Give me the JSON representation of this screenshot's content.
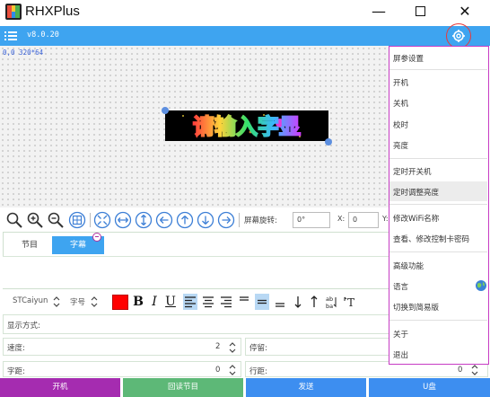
{
  "app": {
    "title": "RHXPlus"
  },
  "toolbar": {
    "version": "v8.0.20"
  },
  "canvas": {
    "coord_label": "0,0 320*64",
    "led_text": "请输入字显"
  },
  "tools": {
    "rotation_label": "屏幕旋转:",
    "rotation_value": "0°",
    "x_label": "X:",
    "x_value": "0",
    "y_label": "Y:"
  },
  "tabs": {
    "program": "节目",
    "subtitle": "字幕"
  },
  "format": {
    "font_name": "STCaiyun",
    "font_size_label": "字号",
    "color": "#ff0000"
  },
  "fields": {
    "display_mode_label": "显示方式:",
    "speed_label": "速度:",
    "speed_value": "2",
    "stay_label": "停留:",
    "spacing_label": "字距:",
    "spacing_value": "0",
    "line_spacing_label": "行距:",
    "line_spacing_value": "0"
  },
  "bottom": {
    "power": "开机",
    "read": "回读节目",
    "send": "发送",
    "usb": "U盘"
  },
  "menu": {
    "screen_params": "屏参设置",
    "power_on": "开机",
    "power_off": "关机",
    "sync_time": "校时",
    "brightness": "亮度",
    "timed_power": "定时开关机",
    "timed_brightness": "定时调整亮度",
    "wifi_name": "修改WiFi名称",
    "card_password": "查看、修改控制卡密码",
    "advanced": "高级功能",
    "language": "语言",
    "simple_mode": "切换到简易版",
    "about": "关于",
    "exit": "退出"
  }
}
